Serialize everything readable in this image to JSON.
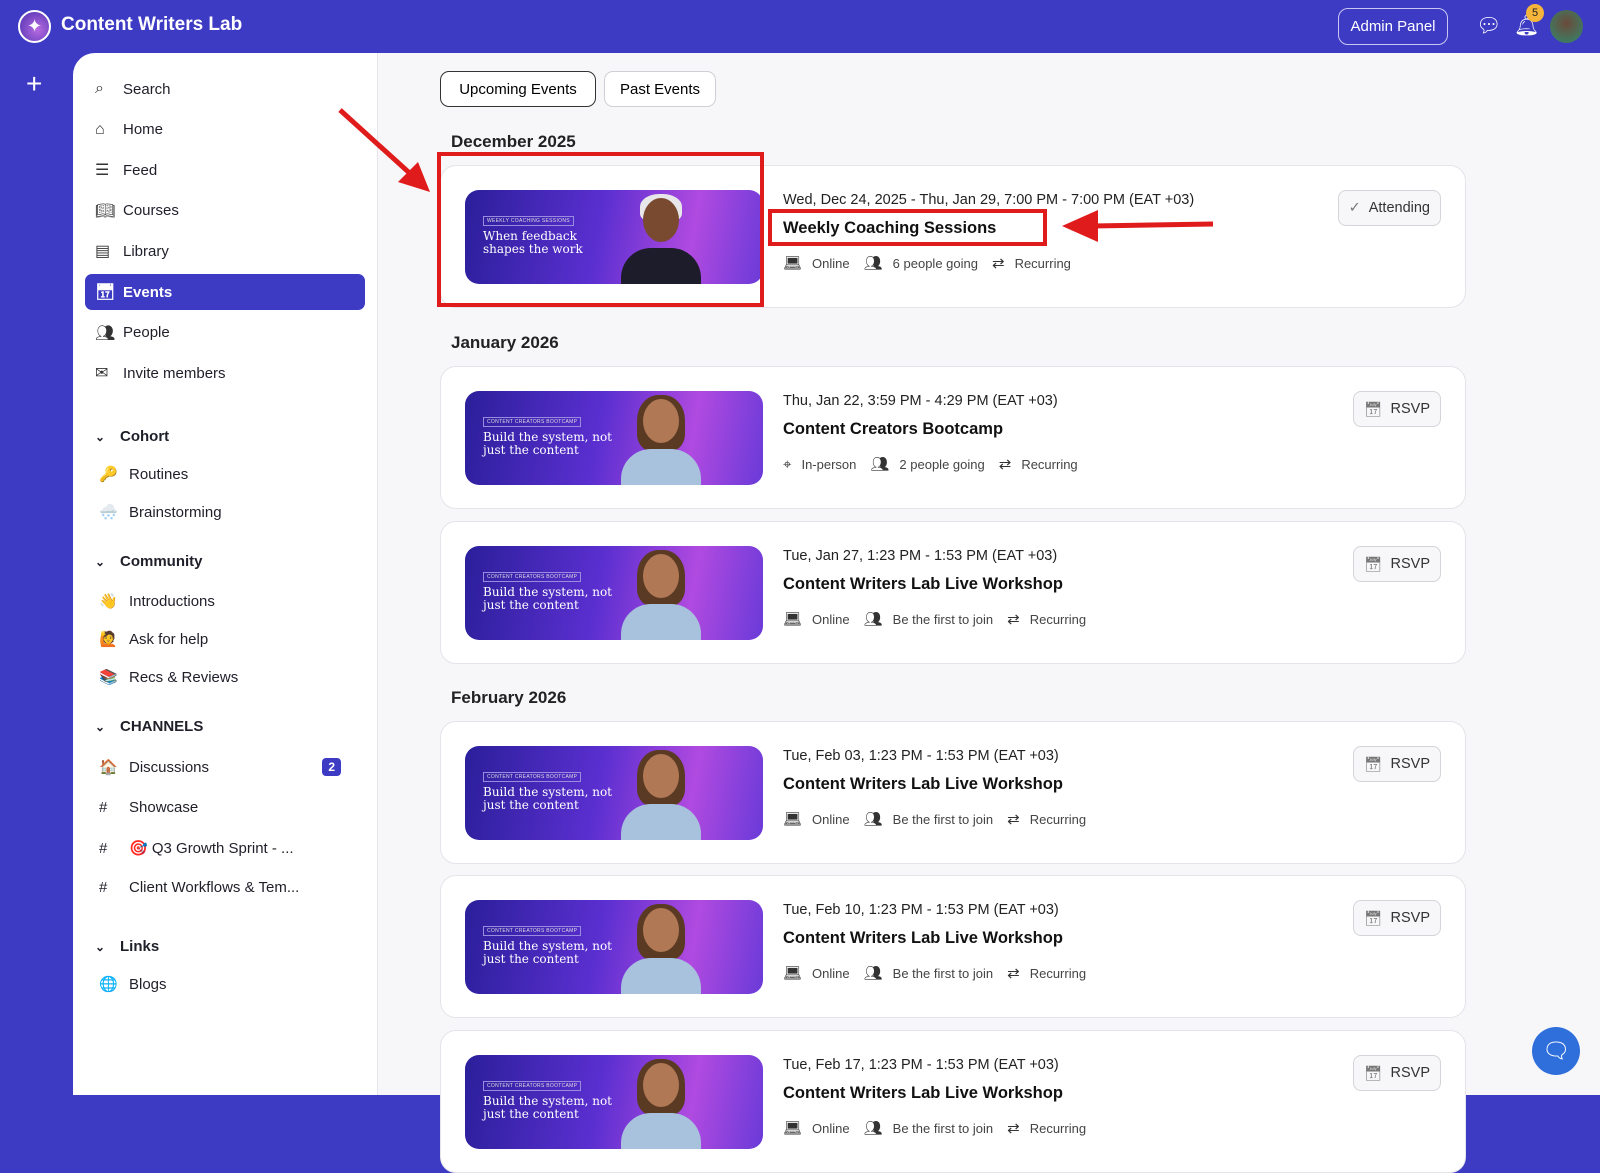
{
  "app": {
    "title": "Content Writers Lab",
    "admin_label": "Admin Panel",
    "notification_count": "5"
  },
  "nav": {
    "items": [
      {
        "label": "Search",
        "icon": "search-icon"
      },
      {
        "label": "Home",
        "icon": "home-icon"
      },
      {
        "label": "Feed",
        "icon": "feed-icon"
      },
      {
        "label": "Courses",
        "icon": "book-icon"
      },
      {
        "label": "Library",
        "icon": "library-icon"
      },
      {
        "label": "Events",
        "icon": "calendar-icon"
      },
      {
        "label": "People",
        "icon": "people-icon"
      },
      {
        "label": "Invite members",
        "icon": "mail-icon"
      }
    ],
    "sections": [
      {
        "title": "Cohort",
        "items": [
          {
            "emoji": "🔑",
            "label": "Routines"
          },
          {
            "emoji": "🌨️",
            "label": "Brainstorming"
          }
        ]
      },
      {
        "title": "Community",
        "items": [
          {
            "emoji": "👋",
            "label": "Introductions"
          },
          {
            "emoji": "🙋",
            "label": "Ask for help"
          },
          {
            "emoji": "📚",
            "label": "Recs & Reviews"
          }
        ]
      },
      {
        "title": "CHANNELS",
        "items": [
          {
            "emoji": "🏠",
            "label": "Discussions",
            "count": "2"
          },
          {
            "emoji": "#",
            "label": "Showcase"
          },
          {
            "emoji": "#",
            "label": "🎯 Q3 Growth Sprint - ..."
          },
          {
            "emoji": "#",
            "label": "Client Workflows & Tem..."
          }
        ]
      },
      {
        "title": "Links",
        "items": [
          {
            "emoji": "🌐",
            "label": "Blogs"
          }
        ]
      }
    ]
  },
  "tabs": {
    "upcoming": "Upcoming Events",
    "past": "Past Events"
  },
  "months": [
    "December 2025",
    "January 2026",
    "February 2026"
  ],
  "events": [
    {
      "when": "Wed, Dec 24, 2025 - Thu, Jan 29, 7:00 PM - 7:00 PM (EAT +03)",
      "title": "Weekly Coaching Sessions",
      "location": "Online",
      "going": "6 people going",
      "recurring": "Recurring",
      "action": "Attending",
      "banner_label": "WEEKLY COACHING SESSIONS",
      "banner_text": "When feedback shapes the work"
    },
    {
      "when": "Thu, Jan 22, 3:59 PM - 4:29 PM (EAT +03)",
      "title": "Content Creators Bootcamp",
      "location": "In-person",
      "going": "2 people going",
      "recurring": "Recurring",
      "action": "RSVP",
      "banner_label": "CONTENT CREATORS BOOTCAMP",
      "banner_text": "Build the system, not just the content"
    },
    {
      "when": "Tue, Jan 27, 1:23 PM - 1:53 PM (EAT +03)",
      "title": "Content Writers Lab Live Workshop",
      "location": "Online",
      "going": "Be the first to join",
      "recurring": "Recurring",
      "action": "RSVP",
      "banner_label": "CONTENT CREATORS BOOTCAMP",
      "banner_text": "Build the system, not just the content"
    },
    {
      "when": "Tue, Feb 03, 1:23 PM - 1:53 PM (EAT +03)",
      "title": "Content Writers Lab Live Workshop",
      "location": "Online",
      "going": "Be the first to join",
      "recurring": "Recurring",
      "action": "RSVP",
      "banner_label": "CONTENT CREATORS BOOTCAMP",
      "banner_text": "Build the system, not just the content"
    },
    {
      "when": "Tue, Feb 10, 1:23 PM - 1:53 PM (EAT +03)",
      "title": "Content Writers Lab Live Workshop",
      "location": "Online",
      "going": "Be the first to join",
      "recurring": "Recurring",
      "action": "RSVP",
      "banner_label": "CONTENT CREATORS BOOTCAMP",
      "banner_text": "Build the system, not just the content"
    },
    {
      "when": "Tue, Feb 17, 1:23 PM - 1:53 PM (EAT +03)",
      "title": "Content Writers Lab Live Workshop",
      "location": "Online",
      "going": "Be the first to join",
      "recurring": "Recurring",
      "action": "RSVP",
      "banner_label": "CONTENT CREATORS BOOTCAMP",
      "banner_text": "Build the system, not just the content"
    }
  ]
}
